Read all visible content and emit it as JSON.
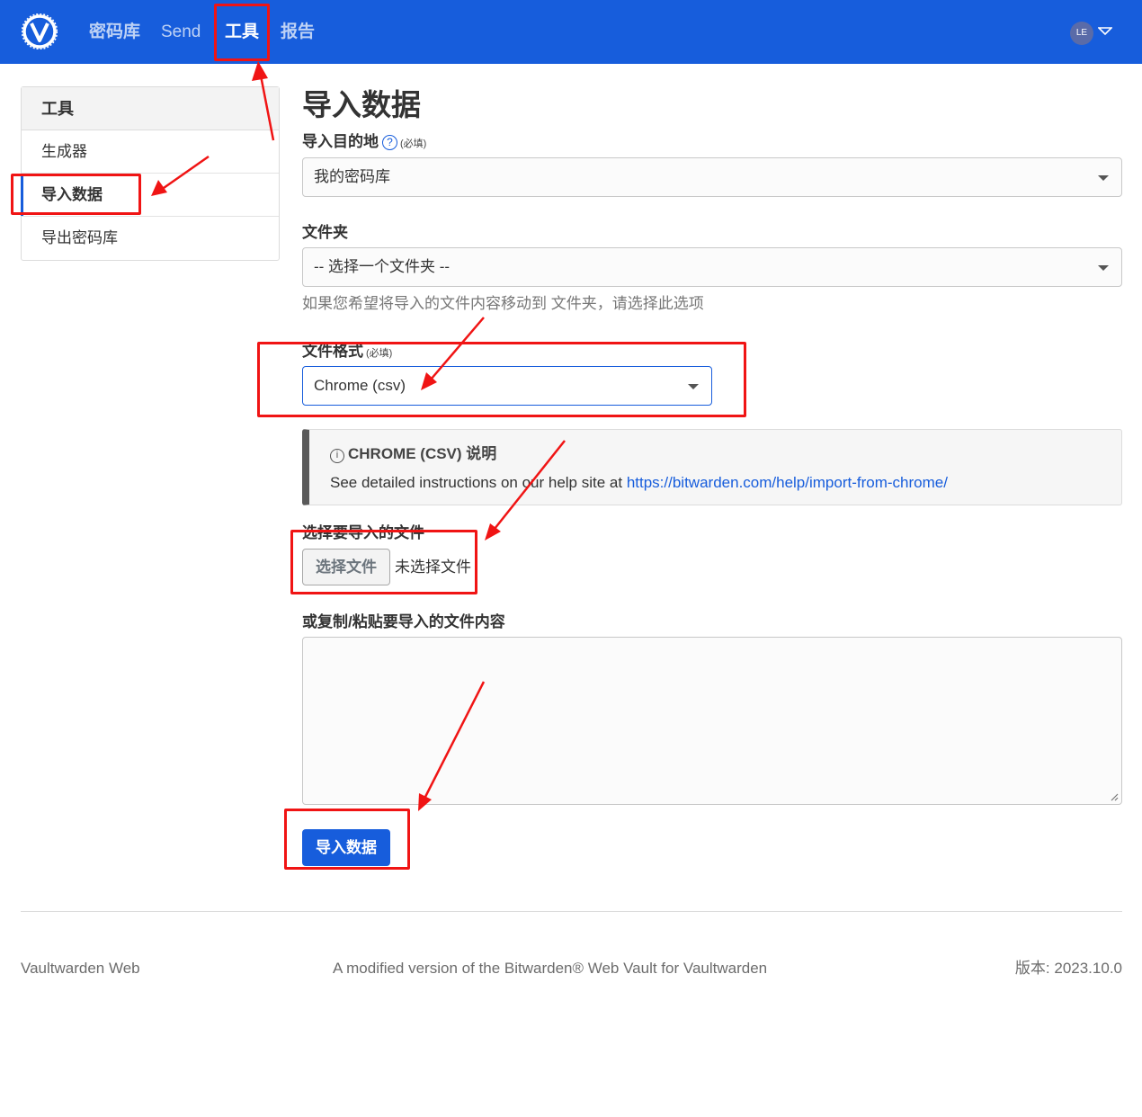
{
  "navbar": {
    "items": [
      {
        "label": "密码库"
      },
      {
        "label": "Send"
      },
      {
        "label": "工具"
      },
      {
        "label": "报告"
      }
    ],
    "avatar_initials": "LE",
    "colors": {
      "background": "#175ddc"
    }
  },
  "sidebar": {
    "heading": "工具",
    "items": [
      {
        "label": "生成器"
      },
      {
        "label": "导入数据"
      },
      {
        "label": "导出密码库"
      }
    ]
  },
  "main": {
    "title": "导入数据",
    "destination": {
      "label": "导入目的地",
      "required": "(必填)",
      "value": "我的密码库"
    },
    "folder": {
      "label": "文件夹",
      "value": "-- 选择一个文件夹 --",
      "hint": "如果您希望将导入的文件内容移动到 文件夹，请选择此选项"
    },
    "format": {
      "label": "文件格式",
      "required": "(必填)",
      "value": "Chrome (csv)"
    },
    "instructions": {
      "title": "CHROME (CSV) 说明",
      "body_prefix": "See detailed instructions on our help site at ",
      "link": "https://bitwarden.com/help/import-from-chrome/"
    },
    "file": {
      "label": "选择要导入的文件",
      "button": "选择文件",
      "status": "未选择文件"
    },
    "paste": {
      "label": "或复制/粘贴要导入的文件内容",
      "value": ""
    },
    "submit": "导入数据"
  },
  "footer": {
    "left": "Vaultwarden Web",
    "center": "A modified version of the Bitwarden® Web Vault for Vaultwarden",
    "right": "版本: 2023.10.0"
  },
  "annotation_color": "#f01414"
}
